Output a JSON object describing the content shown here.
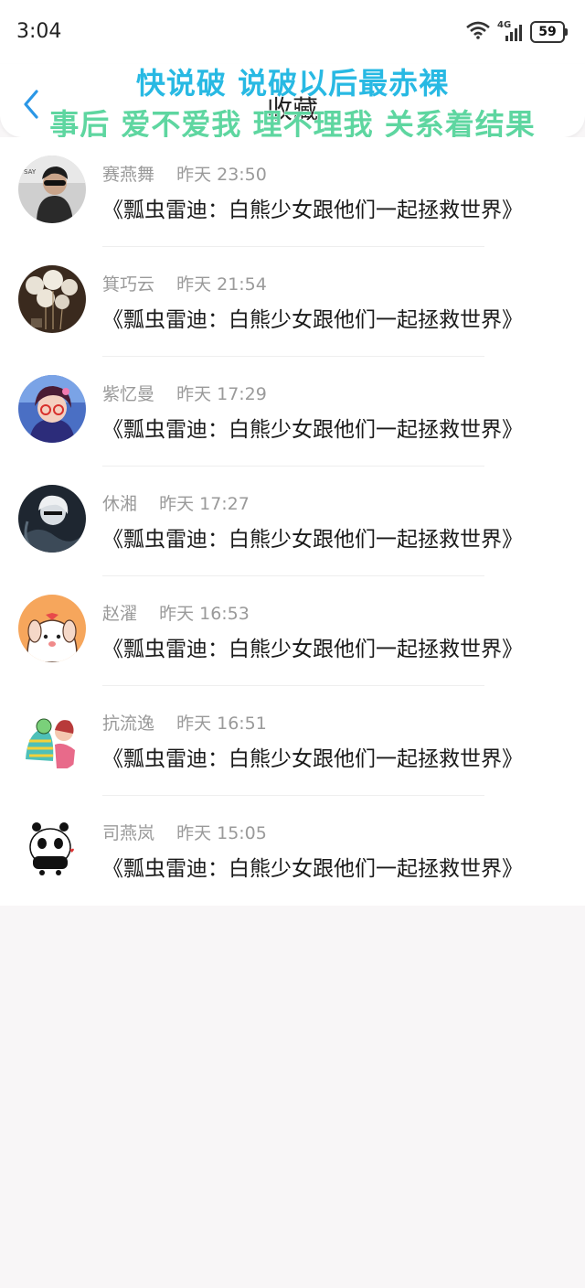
{
  "status_bar": {
    "time": "3:04",
    "network": "4G",
    "battery": "59"
  },
  "header": {
    "title": "收藏",
    "back_icon": "chevron-left-icon",
    "accent": "#2b97e6"
  },
  "lyrics": {
    "line1": "快说破 说破以后最赤裸",
    "line2": "事后 爱不爱我 理不理我 关系着结果"
  },
  "items": [
    {
      "name": "赛燕舞",
      "time": "昨天 23:50",
      "message": "《瓢虫雷迪：白熊少女跟他们一起拯救世界》",
      "avatar": "photo-man-sunglasses"
    },
    {
      "name": "箕巧云",
      "time": "昨天 21:54",
      "message": "《瓢虫雷迪：白熊少女跟他们一起拯救世界》",
      "avatar": "dandelion-photo"
    },
    {
      "name": "紫忆曼",
      "time": "昨天 17:29",
      "message": "《瓢虫雷迪：白熊少女跟他们一起拯救世界》",
      "avatar": "anime-girl-glasses"
    },
    {
      "name": "休湘",
      "time": "昨天 17:27",
      "message": "《瓢虫雷迪：白熊少女跟他们一起拯救世界》",
      "avatar": "dark-anime-character"
    },
    {
      "name": "赵濯",
      "time": "昨天 16:53",
      "message": "《瓢虫雷迪：白熊少女跟他们一起拯救世界》",
      "avatar": "cartoon-dog"
    },
    {
      "name": "抗流逸",
      "time": "昨天 16:51",
      "message": "《瓢虫雷迪：白熊少女跟他们一起拯救世界》",
      "avatar": "cartoon-couple"
    },
    {
      "name": "司燕岚",
      "time": "昨天 15:05",
      "message": "《瓢虫雷迪：白熊少女跟他们一起拯救世界》",
      "avatar": "cartoon-panda"
    }
  ]
}
